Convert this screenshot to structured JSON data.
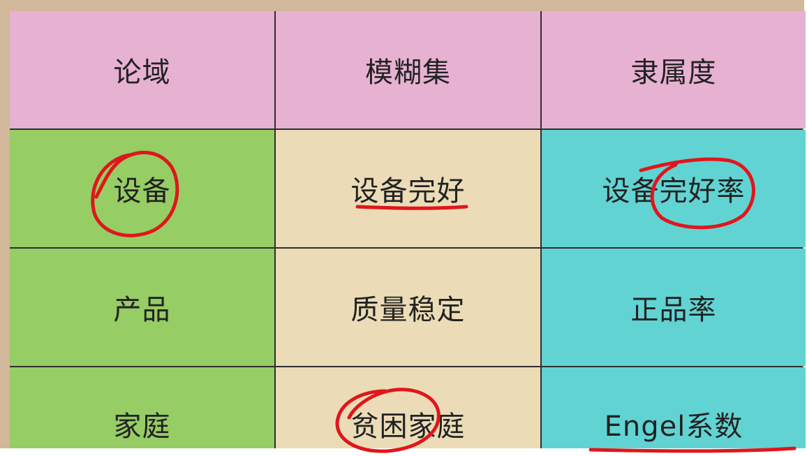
{
  "table": {
    "headers": [
      "论域",
      "模糊集",
      "隶属度"
    ],
    "rows": [
      [
        "设备",
        "设备完好",
        "设备完好率"
      ],
      [
        "产品",
        "质量稳定",
        "正品率"
      ],
      [
        "家庭",
        "贫困家庭",
        "Engel系数"
      ]
    ]
  },
  "colors": {
    "header": "#e7b1d2",
    "col1": "#96cd64",
    "col2": "#ebdcb7",
    "col3": "#62d3d3",
    "annotation": "#e0161b"
  }
}
